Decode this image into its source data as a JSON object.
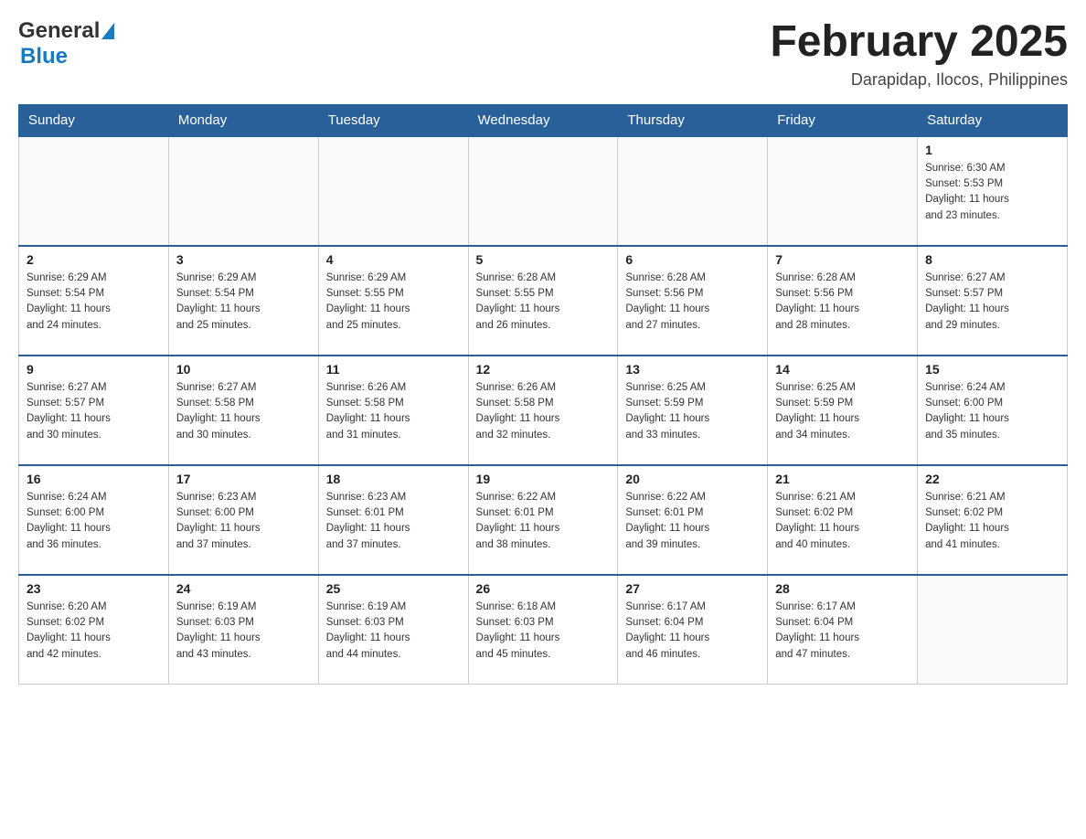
{
  "header": {
    "logo_general": "General",
    "logo_blue": "Blue",
    "month_title": "February 2025",
    "location": "Darapidap, Ilocos, Philippines"
  },
  "days_of_week": [
    "Sunday",
    "Monday",
    "Tuesday",
    "Wednesday",
    "Thursday",
    "Friday",
    "Saturday"
  ],
  "weeks": [
    [
      {
        "day": "",
        "info": ""
      },
      {
        "day": "",
        "info": ""
      },
      {
        "day": "",
        "info": ""
      },
      {
        "day": "",
        "info": ""
      },
      {
        "day": "",
        "info": ""
      },
      {
        "day": "",
        "info": ""
      },
      {
        "day": "1",
        "info": "Sunrise: 6:30 AM\nSunset: 5:53 PM\nDaylight: 11 hours\nand 23 minutes."
      }
    ],
    [
      {
        "day": "2",
        "info": "Sunrise: 6:29 AM\nSunset: 5:54 PM\nDaylight: 11 hours\nand 24 minutes."
      },
      {
        "day": "3",
        "info": "Sunrise: 6:29 AM\nSunset: 5:54 PM\nDaylight: 11 hours\nand 25 minutes."
      },
      {
        "day": "4",
        "info": "Sunrise: 6:29 AM\nSunset: 5:55 PM\nDaylight: 11 hours\nand 25 minutes."
      },
      {
        "day": "5",
        "info": "Sunrise: 6:28 AM\nSunset: 5:55 PM\nDaylight: 11 hours\nand 26 minutes."
      },
      {
        "day": "6",
        "info": "Sunrise: 6:28 AM\nSunset: 5:56 PM\nDaylight: 11 hours\nand 27 minutes."
      },
      {
        "day": "7",
        "info": "Sunrise: 6:28 AM\nSunset: 5:56 PM\nDaylight: 11 hours\nand 28 minutes."
      },
      {
        "day": "8",
        "info": "Sunrise: 6:27 AM\nSunset: 5:57 PM\nDaylight: 11 hours\nand 29 minutes."
      }
    ],
    [
      {
        "day": "9",
        "info": "Sunrise: 6:27 AM\nSunset: 5:57 PM\nDaylight: 11 hours\nand 30 minutes."
      },
      {
        "day": "10",
        "info": "Sunrise: 6:27 AM\nSunset: 5:58 PM\nDaylight: 11 hours\nand 30 minutes."
      },
      {
        "day": "11",
        "info": "Sunrise: 6:26 AM\nSunset: 5:58 PM\nDaylight: 11 hours\nand 31 minutes."
      },
      {
        "day": "12",
        "info": "Sunrise: 6:26 AM\nSunset: 5:58 PM\nDaylight: 11 hours\nand 32 minutes."
      },
      {
        "day": "13",
        "info": "Sunrise: 6:25 AM\nSunset: 5:59 PM\nDaylight: 11 hours\nand 33 minutes."
      },
      {
        "day": "14",
        "info": "Sunrise: 6:25 AM\nSunset: 5:59 PM\nDaylight: 11 hours\nand 34 minutes."
      },
      {
        "day": "15",
        "info": "Sunrise: 6:24 AM\nSunset: 6:00 PM\nDaylight: 11 hours\nand 35 minutes."
      }
    ],
    [
      {
        "day": "16",
        "info": "Sunrise: 6:24 AM\nSunset: 6:00 PM\nDaylight: 11 hours\nand 36 minutes."
      },
      {
        "day": "17",
        "info": "Sunrise: 6:23 AM\nSunset: 6:00 PM\nDaylight: 11 hours\nand 37 minutes."
      },
      {
        "day": "18",
        "info": "Sunrise: 6:23 AM\nSunset: 6:01 PM\nDaylight: 11 hours\nand 37 minutes."
      },
      {
        "day": "19",
        "info": "Sunrise: 6:22 AM\nSunset: 6:01 PM\nDaylight: 11 hours\nand 38 minutes."
      },
      {
        "day": "20",
        "info": "Sunrise: 6:22 AM\nSunset: 6:01 PM\nDaylight: 11 hours\nand 39 minutes."
      },
      {
        "day": "21",
        "info": "Sunrise: 6:21 AM\nSunset: 6:02 PM\nDaylight: 11 hours\nand 40 minutes."
      },
      {
        "day": "22",
        "info": "Sunrise: 6:21 AM\nSunset: 6:02 PM\nDaylight: 11 hours\nand 41 minutes."
      }
    ],
    [
      {
        "day": "23",
        "info": "Sunrise: 6:20 AM\nSunset: 6:02 PM\nDaylight: 11 hours\nand 42 minutes."
      },
      {
        "day": "24",
        "info": "Sunrise: 6:19 AM\nSunset: 6:03 PM\nDaylight: 11 hours\nand 43 minutes."
      },
      {
        "day": "25",
        "info": "Sunrise: 6:19 AM\nSunset: 6:03 PM\nDaylight: 11 hours\nand 44 minutes."
      },
      {
        "day": "26",
        "info": "Sunrise: 6:18 AM\nSunset: 6:03 PM\nDaylight: 11 hours\nand 45 minutes."
      },
      {
        "day": "27",
        "info": "Sunrise: 6:17 AM\nSunset: 6:04 PM\nDaylight: 11 hours\nand 46 minutes."
      },
      {
        "day": "28",
        "info": "Sunrise: 6:17 AM\nSunset: 6:04 PM\nDaylight: 11 hours\nand 47 minutes."
      },
      {
        "day": "",
        "info": ""
      }
    ]
  ]
}
